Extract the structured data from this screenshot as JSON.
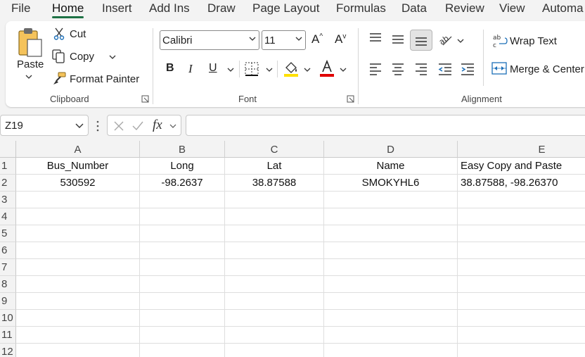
{
  "menu": {
    "tabs": [
      "File",
      "Home",
      "Insert",
      "Add Ins",
      "Draw",
      "Page Layout",
      "Formulas",
      "Data",
      "Review",
      "View",
      "Automa"
    ],
    "active": "Home"
  },
  "clipboard": {
    "paste": "Paste",
    "cut": "Cut",
    "copy": "Copy",
    "format_painter": "Format Painter",
    "label": "Clipboard"
  },
  "font": {
    "family": "Calibri",
    "size": "11",
    "grow_label": "A",
    "shrink_label": "A",
    "bold": "B",
    "italic": "I",
    "underline": "U",
    "label": "Font",
    "highlight_color": "#ffe000",
    "font_color": "#e00000"
  },
  "alignment": {
    "wrap_text": "Wrap Text",
    "merge_center": "Merge & Center",
    "label": "Alignment"
  },
  "formula_bar": {
    "name_box": "Z19",
    "fx": "fx",
    "formula": ""
  },
  "sheet": {
    "columns": [
      "A",
      "B",
      "C",
      "D",
      "E"
    ],
    "rows": [
      "1",
      "2",
      "3",
      "4",
      "5",
      "6",
      "7",
      "8",
      "9",
      "10",
      "11",
      "12"
    ],
    "cells": [
      [
        "Bus_Number",
        "Long",
        "Lat",
        "Name",
        "Easy Copy and Paste"
      ],
      [
        "530592",
        "-98.2637",
        "38.87588",
        "SMOKYHL6",
        "38.87588, -98.26370"
      ]
    ]
  },
  "colors": {
    "accent": "#1e7145",
    "ribbon_bg": "#f3f3f3"
  }
}
